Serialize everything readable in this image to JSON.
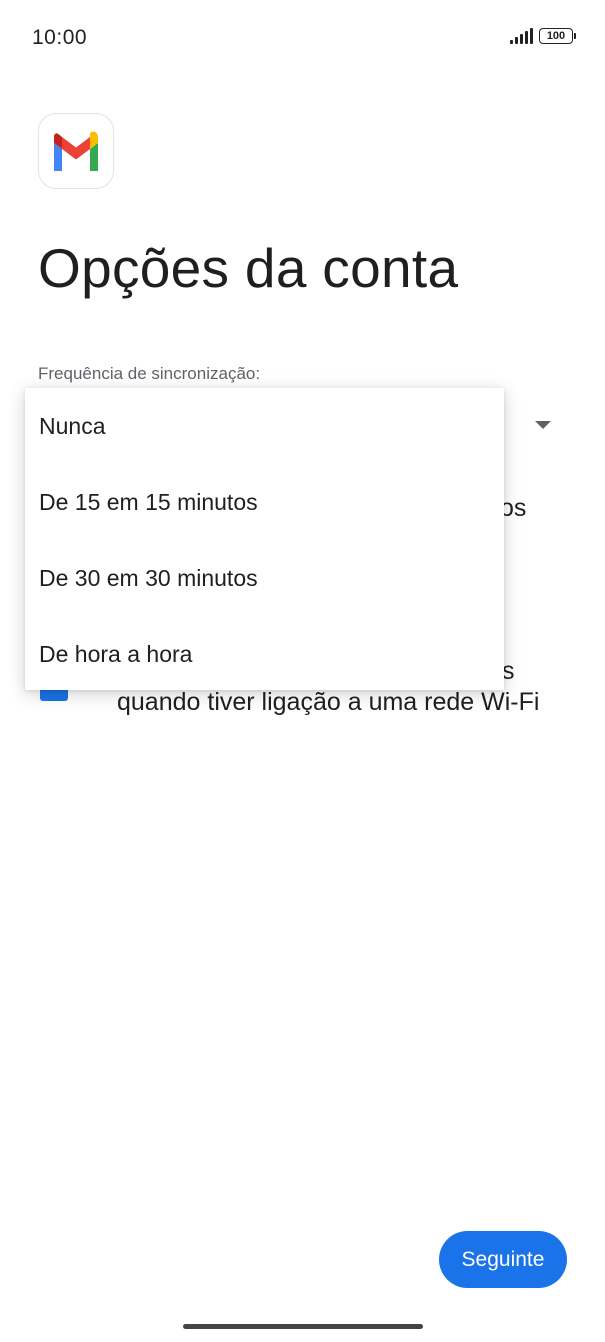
{
  "status_bar": {
    "time": "10:00",
    "battery": "100",
    "icons": [
      "signal-icon",
      "battery-icon"
    ]
  },
  "app": {
    "logo_icon": "gmail-logo-icon"
  },
  "page": {
    "title": "Opções da conta",
    "sync_label": "Frequência de sincronização:"
  },
  "underlay": {
    "partial_text_1": "os",
    "partial_text_2": "s",
    "wifi_option_text": "quando tiver ligação a uma rede Wi-Fi"
  },
  "dropdown": {
    "options": [
      "Nunca",
      "De 15 em 15 minutos",
      "De 30 em 30 minutos",
      "De hora a hora"
    ]
  },
  "footer": {
    "next_label": "Seguinte"
  },
  "colors": {
    "accent": "#1a73e8",
    "text_primary": "#1f1f1f",
    "text_secondary": "#5f6368",
    "gmail_red": "#ea4335",
    "gmail_blue": "#4285f4",
    "gmail_green": "#34a853",
    "gmail_yellow": "#fbbc04",
    "gmail_dark_red": "#c5221f"
  }
}
